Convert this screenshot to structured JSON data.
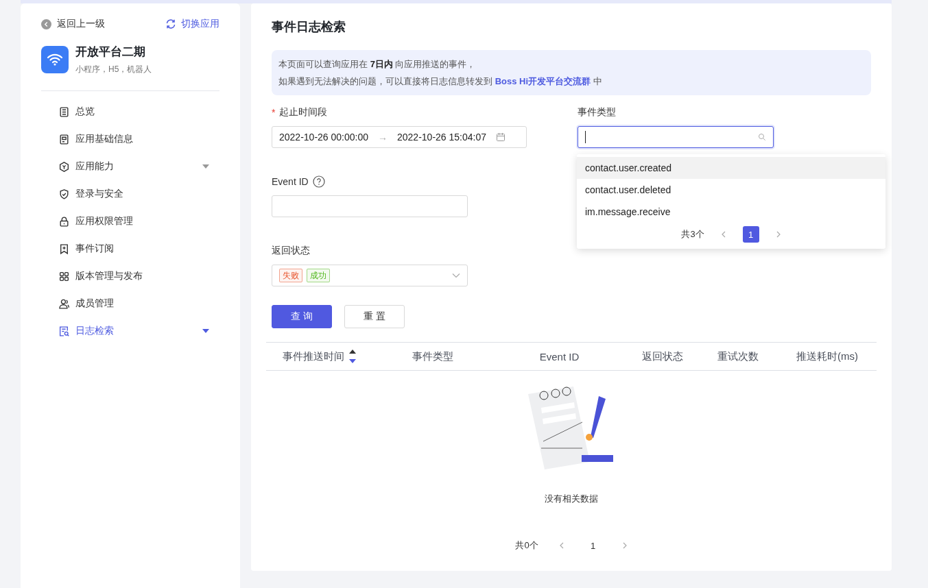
{
  "sidebar": {
    "back_link": "返回上一级",
    "switch_link": "切换应用",
    "app": {
      "name": "开放平台二期",
      "subtitle": "小程序，H5，机器人"
    },
    "nav_items": [
      {
        "label": "总览",
        "selected": false,
        "expandable": false
      },
      {
        "label": "应用基础信息",
        "selected": false,
        "expandable": false
      },
      {
        "label": "应用能力",
        "selected": false,
        "expandable": true
      },
      {
        "label": "登录与安全",
        "selected": false,
        "expandable": false
      },
      {
        "label": "应用权限管理",
        "selected": false,
        "expandable": false
      },
      {
        "label": "事件订阅",
        "selected": false,
        "expandable": false
      },
      {
        "label": "版本管理与发布",
        "selected": false,
        "expandable": false
      },
      {
        "label": "成员管理",
        "selected": false,
        "expandable": false
      },
      {
        "label": "日志检索",
        "selected": true,
        "expandable": true
      }
    ]
  },
  "main": {
    "title": "事件日志检索",
    "notice": {
      "line_1": "本页面可以查询应用在 **7日内** 向应用推送的事件，",
      "line_2_before": "如果遇到无法解决的问题，可以直接将日志信息转发到 ",
      "line_2_link": "Boss Hi开发平台交流群",
      "line_2_after": " 中"
    },
    "form": {
      "date_range": {
        "label": "起止时间段",
        "required_mark": "*",
        "start": "2022-10-26 00:00:00",
        "separator": "→",
        "end": "2022-10-26 15:04:07"
      },
      "event_type": {
        "label": "事件类型",
        "focused": true,
        "dropdown": {
          "options": [
            {
              "label": "contact.user.created",
              "selected": true
            },
            {
              "label": "contact.user.deleted",
              "selected": false
            },
            {
              "label": "im.message.receive",
              "selected": false
            }
          ],
          "total": "共3个",
          "pages": [
            {
              "label": "1",
              "selected": true
            }
          ]
        }
      },
      "event_id": {
        "label": "Event ID"
      },
      "status": {
        "label": "返回状态",
        "tags": [
          {
            "text": "失败",
            "color": "#e8562f"
          },
          {
            "text": "成功",
            "color": "#52b71e"
          }
        ]
      },
      "buttons": [
        {
          "label": "查 询",
          "kind": "primary"
        },
        {
          "label": "重 置",
          "kind": "default"
        }
      ]
    },
    "table": {
      "columns": [
        {
          "label": "事件推送时间",
          "sorted": true
        },
        {
          "label": "事件类型",
          "sorted": false
        },
        {
          "label": "Event ID",
          "sorted": false
        },
        {
          "label": "返回状态",
          "sorted": false
        },
        {
          "label": "重试次数",
          "sorted": false
        },
        {
          "label": "推送耗时(ms)",
          "sorted": false
        }
      ],
      "empty_text": "没有相关数据",
      "total": "共0个",
      "pages": [
        {
          "label": "1",
          "selected": false
        }
      ]
    }
  }
}
